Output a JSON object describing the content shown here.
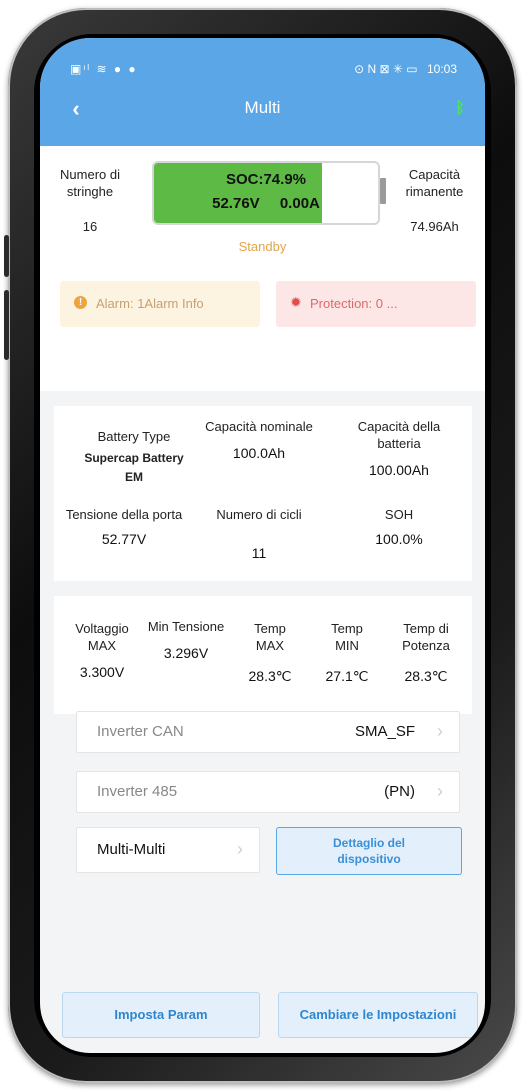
{
  "status_bar": {
    "left_icons": "▣ᶦˡ ≋ ● ●",
    "right_icons": "⊙ N ⊠ ✳ ▭",
    "time": "10:03"
  },
  "header": {
    "back_icon": "‹",
    "title": "Multi",
    "bluetooth_icon": "ᛒ"
  },
  "battery": {
    "strings_label": "Numero di stringhe",
    "strings_value": "16",
    "soc": "SOC:74.9%",
    "voltage": "52.76V",
    "current": "0.00A",
    "soc_fraction": 0.749,
    "remaining_label": "Capacità rimanente",
    "remaining_value": "74.96Ah",
    "state": "Standby",
    "fill_color": "#5cba45"
  },
  "alarm": {
    "label": "Alarm:",
    "value": "1Alarm Info"
  },
  "protection": {
    "label": "Protection:",
    "value": "0 ..."
  },
  "info": {
    "battery_type_label": "Battery Type",
    "battery_type_value": "Supercap Battery EM",
    "nominal_label": "Capacità nominale",
    "nominal_value": "100.0Ah",
    "capacity_label": "Capacità della batteria",
    "capacity_value": "100.00Ah",
    "port_voltage_label": "Tensione della porta",
    "port_voltage_value": "52.77V",
    "cycles_label": "Numero di cicli",
    "cycles_value": "11",
    "soh_label": "SOH",
    "soh_value": "100.0%"
  },
  "voltages": {
    "vmax_label": "Voltaggio MAX",
    "vmax_value": "3.300V",
    "vmin_label": "Min Tensione",
    "vmin_value": "3.296V",
    "tmax_label": "Temp MAX",
    "tmax_value": "28.3℃",
    "tmin_label": "Temp MIN",
    "tmin_value": "27.1℃",
    "tpow_label": "Temp di Potenza",
    "tpow_value": "28.3℃"
  },
  "rows": {
    "inverter_can_label": "Inverter CAN",
    "inverter_can_value": "SMA_SF",
    "inverter_485_label": "Inverter 485",
    "inverter_485_value": "(PN)",
    "multi_label": "Multi-Multi",
    "detail_label": "Dettaglio del dispositivo",
    "chevron": "›"
  },
  "buttons": {
    "set_params": "Imposta Param",
    "change_settings": "Cambiare le Impostazioni"
  },
  "colors": {
    "header": "#5aa6e6",
    "alarm_bg": "#fdf3e1",
    "protection_bg": "#fde6e6",
    "standby": "#e1a54a"
  }
}
